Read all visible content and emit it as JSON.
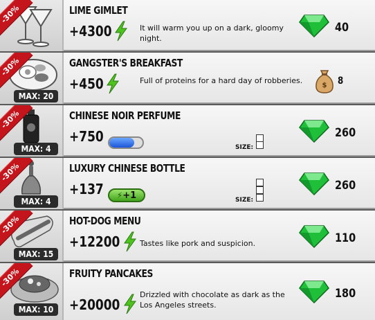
{
  "items": [
    {
      "title": "LIME GIMLET",
      "discount": "-30%",
      "max": "",
      "value": "+4300",
      "desc": "It will warm you up on a dark, gloomy night.",
      "price": "40",
      "currency": "gem-icon"
    },
    {
      "title": "GANGSTER'S BREAKFAST",
      "discount": "-30%",
      "max": "MAX: 20",
      "value": "+450",
      "desc": "Full of proteins for a hard day of robberies.",
      "price": "8",
      "currency": "money-bag-icon"
    },
    {
      "title": "CHINESE NOIR PERFUME",
      "discount": "-30%",
      "max": "MAX: 4",
      "value": "+750",
      "desc": "",
      "price": "260",
      "currency": "gem-icon",
      "size_label": "SIZE:",
      "size_slots": 1,
      "energy_fill": 0.74
    },
    {
      "title": "LUXURY CHINESE BOTTLE",
      "discount": "-30%",
      "max": "MAX: 4",
      "value": "+137",
      "desc": "",
      "price": "260",
      "currency": "gem-icon",
      "size_label": "SIZE:",
      "size_slots": 3,
      "energy_plus": "+1"
    },
    {
      "title": "HOT-DOG MENU",
      "discount": "-30%",
      "max": "MAX: 15",
      "value": "+12200",
      "desc": "Tastes like pork and suspicion.",
      "price": "110",
      "currency": "gem-icon"
    },
    {
      "title": "FRUITY PANCAKES",
      "discount": "-30%",
      "max": "MAX: 10",
      "value": "+20000",
      "desc": "Drizzled with chocolate as dark as the Los Angeles streets.",
      "price": "180",
      "currency": "gem-icon"
    }
  ],
  "colors": {
    "ribbon": "#c4151c",
    "gem": "#1fbf3a",
    "energy": "#3fbf1f"
  }
}
